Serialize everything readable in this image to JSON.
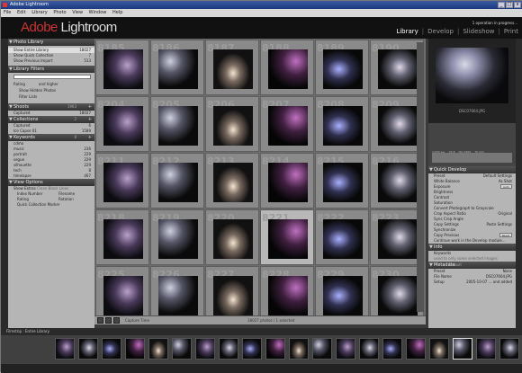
{
  "window": {
    "title": "Adobe Lightroom",
    "buttons": [
      "_",
      "□",
      "x"
    ]
  },
  "menu": [
    "File",
    "Edit",
    "Library",
    "Photo",
    "View",
    "Window",
    "Help"
  ],
  "identity": {
    "logo_adobe": "Adobe",
    "logo_product": "Lightroom",
    "status": "1 operation in progress..."
  },
  "modules": [
    "Library",
    "Develop",
    "Slideshow",
    "Print"
  ],
  "modules_sep": "|",
  "library": {
    "header": "Photo Library",
    "rows": [
      {
        "label": "Show Entire Library",
        "count": "18027"
      },
      {
        "label": "Show Quick Collection",
        "count": "7"
      },
      {
        "label": "Show Previous Import",
        "count": "513"
      }
    ]
  },
  "filters": {
    "header": "Library Filters",
    "rating_label": "Rating",
    "rating_mode": "and higher",
    "hidden": "Show Hidden Photos",
    "filter_lists": "Filter Lists"
  },
  "shoots": {
    "header": "Shoots",
    "count": "1963",
    "rows": [
      {
        "label": "Captured",
        "count": "18027"
      }
    ]
  },
  "collections": {
    "header": "Collections",
    "count": "2",
    "rows": [
      {
        "label": "Captured",
        "count": "6"
      },
      {
        "label": "Ice Capse 01",
        "count": "1589"
      }
    ]
  },
  "keywords": {
    "header": "Keywords",
    "count": "8",
    "rows": [
      {
        "label": "cdmo",
        "count": ""
      },
      {
        "label": "music",
        "count": "236"
      },
      {
        "label": "portrait",
        "count": "229"
      },
      {
        "label": "segue",
        "count": "229"
      },
      {
        "label": "silhouette",
        "count": "229"
      },
      {
        "label": "tech",
        "count": "8"
      },
      {
        "label": "timelapse",
        "count": "467"
      }
    ]
  },
  "view_options": {
    "header": "View Options",
    "show_extras": "Show Extras",
    "extras_mode": "Clean Black Lines",
    "items": [
      "Index Number",
      "Filename",
      "Rating",
      "Rotation",
      "Quick Collection Marker"
    ]
  },
  "grid": {
    "status": "18027 photos / 1 selected",
    "sort": "Capture Time",
    "cells": [
      {
        "n": "8185"
      },
      {
        "n": "8186"
      },
      {
        "n": "8187"
      },
      {
        "n": "8188"
      },
      {
        "n": "8189"
      },
      {
        "n": "8190"
      },
      {
        "n": "8204"
      },
      {
        "n": "8205"
      },
      {
        "n": "8206"
      },
      {
        "n": "8207"
      },
      {
        "n": "8208"
      },
      {
        "n": "8209"
      },
      {
        "n": "8211"
      },
      {
        "n": "8212"
      },
      {
        "n": "8213"
      },
      {
        "n": "8214"
      },
      {
        "n": "8215"
      },
      {
        "n": "8216"
      },
      {
        "n": "8218"
      },
      {
        "n": "8219"
      },
      {
        "n": "8220"
      },
      {
        "n": "8221"
      },
      {
        "n": "8222"
      },
      {
        "n": "8223"
      },
      {
        "n": "8225"
      },
      {
        "n": "8226"
      },
      {
        "n": "8227"
      },
      {
        "n": "8228"
      },
      {
        "n": "8229"
      },
      {
        "n": "8230"
      }
    ]
  },
  "navigator": {
    "filename": "DSC07664.JPG"
  },
  "histogram": {
    "readout": [
      "1/250 sec",
      "f/2.8",
      "ISO 1600",
      "70 mm"
    ]
  },
  "quick_develop": {
    "header": "Quick Develop",
    "preset_label": "Preset",
    "preset_value": "Default Settings",
    "wb_label": "White Balance",
    "wb_value": "As Shot",
    "adjust": [
      "Exposure",
      "Brightness",
      "Contrast",
      "Saturation"
    ],
    "auto": "Auto",
    "grayscale": "Convert Photograph to Grayscale",
    "crop_label": "Crop Aspect Ratio",
    "crop_value": "Original",
    "sync_crop": "Sync Crop Angle",
    "copy": [
      "Copy Settings",
      "Synchronize",
      "Copy Previous"
    ],
    "paste": "Paste Settings",
    "reset": "Reset",
    "continue": "Continue work in the Develop module..."
  },
  "info": {
    "header": "Info",
    "keywords_label": "Keywords",
    "keywords_hint": "used to only some selected images"
  },
  "metadata": {
    "header": "Metadata",
    "preset": "Default",
    "rows": [
      {
        "label": "Preset",
        "value": "None"
      },
      {
        "label": "File Name",
        "value": "DSC07664.JPG"
      },
      {
        "label": "Setup",
        "value": "2005-10-07 ... and added"
      }
    ]
  },
  "filmstrip": {
    "label": "Filmstrip",
    "source": "Entire Library"
  },
  "icons": {
    "grid": "grid-icon",
    "loupe": "loupe-icon",
    "compare": "compare-icon"
  },
  "colors": {
    "accent": "#c33",
    "panel": "#b5b5b5",
    "dark": "#111"
  }
}
